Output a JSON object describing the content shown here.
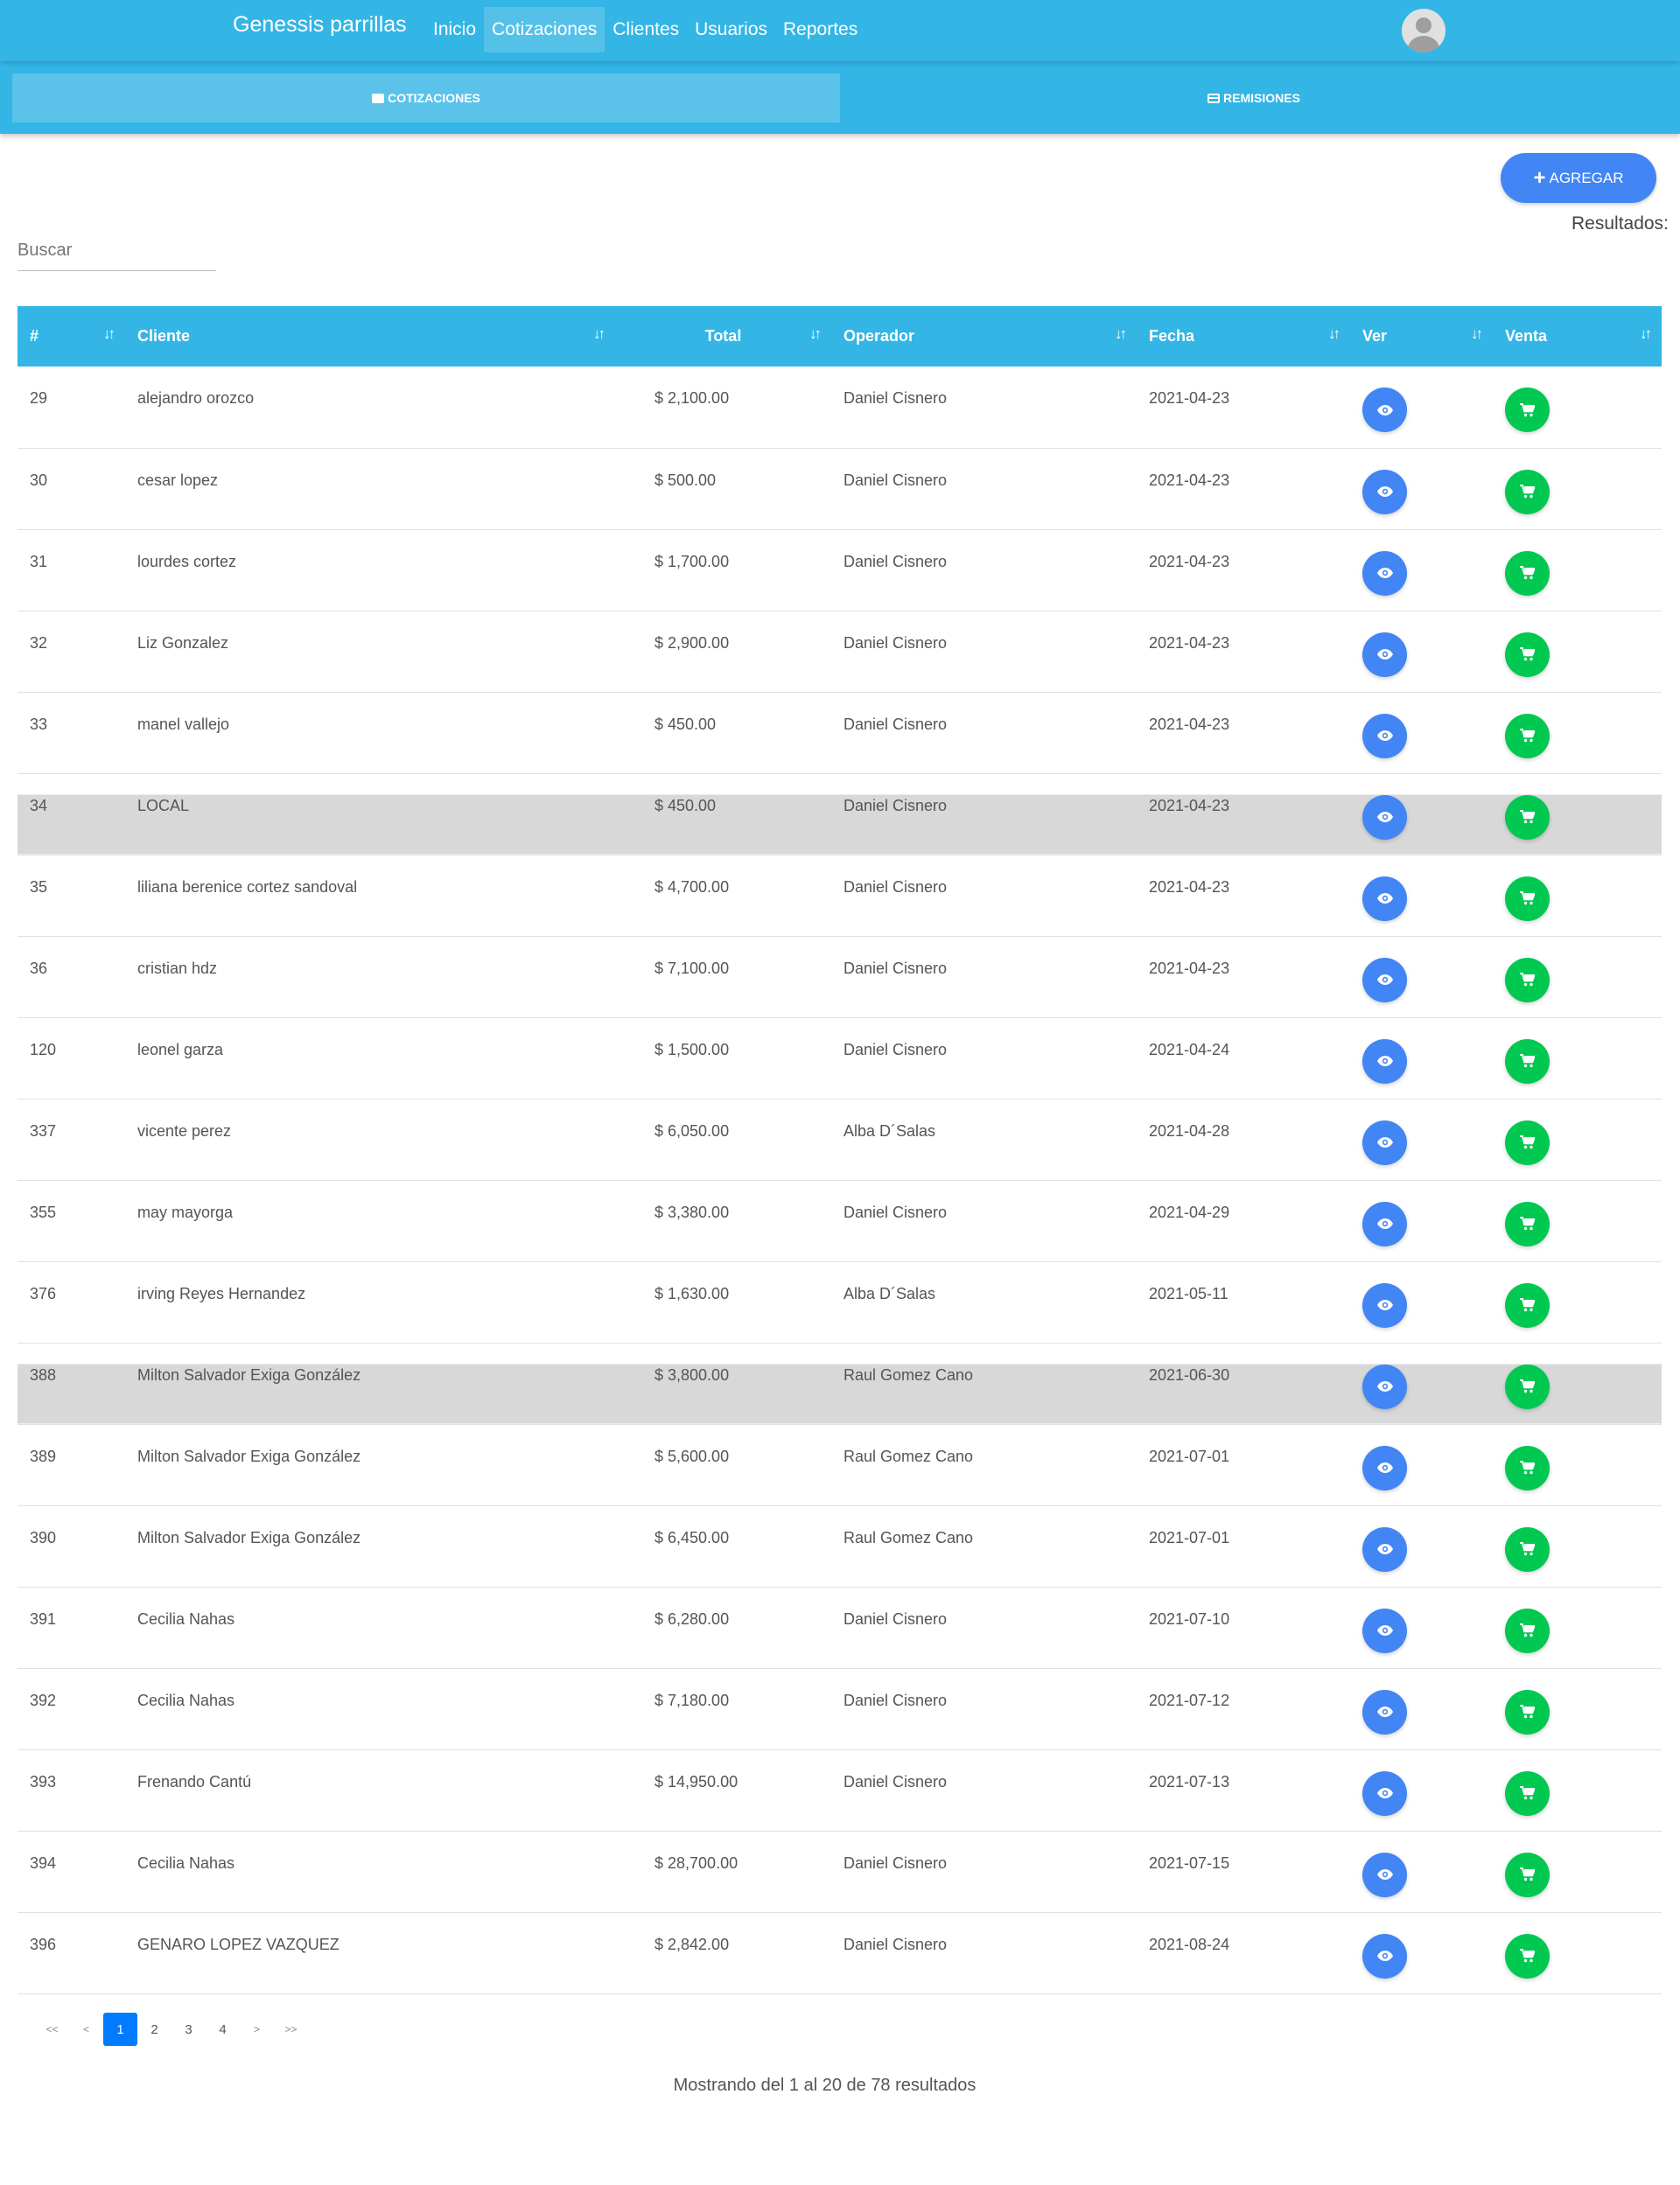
{
  "app": {
    "brand": "Genessis parrillas"
  },
  "nav": {
    "items": [
      {
        "label": "Inicio"
      },
      {
        "label": "Cotizaciones"
      },
      {
        "label": "Clientes"
      },
      {
        "label": "Usuarios"
      },
      {
        "label": "Reportes"
      }
    ],
    "active_index": 1
  },
  "subnav": {
    "tabs": [
      {
        "label": "COTIZACIONES",
        "icon": "briefcase-icon"
      },
      {
        "label": "REMISIONES",
        "icon": "credit-card-icon"
      }
    ],
    "active_index": 0
  },
  "toolbar": {
    "add_label": "AGREGAR",
    "add_icon": "plus-icon",
    "results_label": "Resultados:"
  },
  "search": {
    "placeholder": "Buscar",
    "value": ""
  },
  "table": {
    "columns": [
      "#",
      "Cliente",
      "Total",
      "Operador",
      "Fecha",
      "Ver",
      "Venta"
    ],
    "sort_icon": "sort-icon",
    "view_icon": "eye-icon",
    "sale_icon": "cart-icon",
    "colors": {
      "header": "#33b5e5",
      "view_button": "#4285f4",
      "sale_button": "#00c851",
      "highlight": "#d8d8d8"
    },
    "rows": [
      {
        "id": "29",
        "cliente": "alejandro orozco",
        "total": "$ 2,100.00",
        "operador": "Daniel Cisnero",
        "fecha": "2021-04-23",
        "highlighted": false
      },
      {
        "id": "30",
        "cliente": "cesar lopez",
        "total": "$ 500.00",
        "operador": "Daniel Cisnero",
        "fecha": "2021-04-23",
        "highlighted": false
      },
      {
        "id": "31",
        "cliente": "lourdes cortez",
        "total": "$ 1,700.00",
        "operador": "Daniel Cisnero",
        "fecha": "2021-04-23",
        "highlighted": false
      },
      {
        "id": "32",
        "cliente": "Liz Gonzalez",
        "total": "$ 2,900.00",
        "operador": "Daniel Cisnero",
        "fecha": "2021-04-23",
        "highlighted": false
      },
      {
        "id": "33",
        "cliente": "manel vallejo",
        "total": "$ 450.00",
        "operador": "Daniel Cisnero",
        "fecha": "2021-04-23",
        "highlighted": false
      },
      {
        "id": "34",
        "cliente": "LOCAL",
        "total": "$ 450.00",
        "operador": "Daniel Cisnero",
        "fecha": "2021-04-23",
        "highlighted": true
      },
      {
        "id": "35",
        "cliente": "liliana berenice cortez sandoval",
        "total": "$ 4,700.00",
        "operador": "Daniel Cisnero",
        "fecha": "2021-04-23",
        "highlighted": false
      },
      {
        "id": "36",
        "cliente": "cristian hdz",
        "total": "$ 7,100.00",
        "operador": "Daniel Cisnero",
        "fecha": "2021-04-23",
        "highlighted": false
      },
      {
        "id": "120",
        "cliente": "leonel garza",
        "total": "$ 1,500.00",
        "operador": "Daniel Cisnero",
        "fecha": "2021-04-24",
        "highlighted": false
      },
      {
        "id": "337",
        "cliente": "vicente perez",
        "total": "$ 6,050.00",
        "operador": "Alba D´Salas",
        "fecha": "2021-04-28",
        "highlighted": false
      },
      {
        "id": "355",
        "cliente": "may mayorga",
        "total": "$ 3,380.00",
        "operador": "Daniel Cisnero",
        "fecha": "2021-04-29",
        "highlighted": false
      },
      {
        "id": "376",
        "cliente": "irving Reyes Hernandez",
        "total": "$ 1,630.00",
        "operador": "Alba D´Salas",
        "fecha": "2021-05-11",
        "highlighted": false
      },
      {
        "id": "388",
        "cliente": "Milton Salvador Exiga González",
        "total": "$ 3,800.00",
        "operador": "Raul Gomez Cano",
        "fecha": "2021-06-30",
        "highlighted": true
      },
      {
        "id": "389",
        "cliente": "Milton Salvador Exiga González",
        "total": "$ 5,600.00",
        "operador": "Raul Gomez Cano",
        "fecha": "2021-07-01",
        "highlighted": false
      },
      {
        "id": "390",
        "cliente": "Milton Salvador Exiga González",
        "total": "$ 6,450.00",
        "operador": "Raul Gomez Cano",
        "fecha": "2021-07-01",
        "highlighted": false
      },
      {
        "id": "391",
        "cliente": "Cecilia Nahas",
        "total": "$ 6,280.00",
        "operador": "Daniel Cisnero",
        "fecha": "2021-07-10",
        "highlighted": false
      },
      {
        "id": "392",
        "cliente": "Cecilia Nahas",
        "total": "$ 7,180.00",
        "operador": "Daniel Cisnero",
        "fecha": "2021-07-12",
        "highlighted": false
      },
      {
        "id": "393",
        "cliente": "Frenando Cantú",
        "total": "$ 14,950.00",
        "operador": "Daniel Cisnero",
        "fecha": "2021-07-13",
        "highlighted": false
      },
      {
        "id": "394",
        "cliente": "Cecilia Nahas",
        "total": "$ 28,700.00",
        "operador": "Daniel Cisnero",
        "fecha": "2021-07-15",
        "highlighted": false
      },
      {
        "id": "396",
        "cliente": "GENARO LOPEZ VAZQUEZ",
        "total": "$ 2,842.00",
        "operador": "Daniel Cisnero",
        "fecha": "2021-08-24",
        "highlighted": false
      }
    ]
  },
  "pagination": {
    "first": "<<",
    "prev": "<",
    "pages": [
      "1",
      "2",
      "3",
      "4"
    ],
    "current_index": 0,
    "next": ">",
    "last": ">>",
    "accent": "#007bff"
  },
  "footer": {
    "summary": "Mostrando del 1 al 20 de 78 resultados"
  }
}
